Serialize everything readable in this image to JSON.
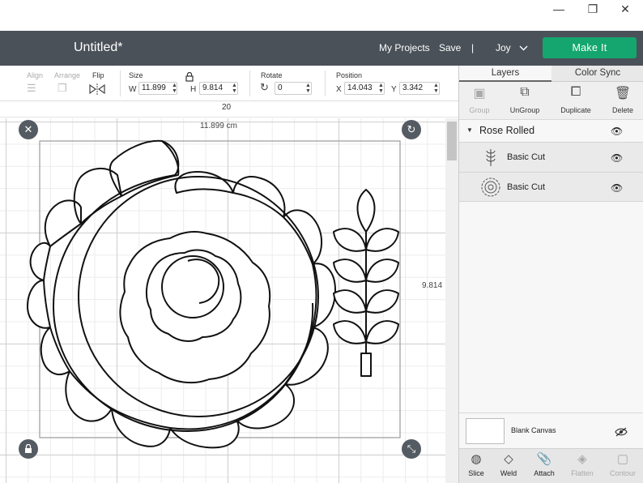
{
  "window": {
    "minimize_glyph": "—",
    "restore_glyph": "❐",
    "close_glyph": "✕"
  },
  "header": {
    "title": "Untitled*",
    "my_projects": "My Projects",
    "save": "Save",
    "divider": "|",
    "user": "Joy",
    "make_it": "Make It"
  },
  "toolbar": {
    "align": "Align",
    "arrange": "Arrange",
    "flip": "Flip",
    "size": "Size",
    "width_label": "W",
    "width_value": "11.899",
    "height_label": "H",
    "height_value": "9.814",
    "rotate": "Rotate",
    "rotate_value": "0",
    "position": "Position",
    "x_label": "X",
    "x_value": "14.043",
    "y_label": "Y",
    "y_value": "3.342"
  },
  "ruler": {
    "marker": "20"
  },
  "canvas": {
    "width_dimension": "11.899 cm",
    "height_dimension": "9.814"
  },
  "panel": {
    "tabs": [
      "Layers",
      "Color Sync"
    ],
    "actions": [
      {
        "label": "Group",
        "icon": "group-icon",
        "disabled": true
      },
      {
        "label": "UnGroup",
        "icon": "ungroup-icon",
        "disabled": false
      },
      {
        "label": "Duplicate",
        "icon": "duplicate-icon",
        "disabled": false
      },
      {
        "label": "Delete",
        "icon": "trash-icon",
        "disabled": false
      }
    ],
    "group_name": "Rose Rolled",
    "layers": [
      {
        "name": "Basic Cut",
        "thumb": "leaf"
      },
      {
        "name": "Basic Cut",
        "thumb": "rose"
      }
    ],
    "blank_canvas": "Blank Canvas",
    "bottom_actions": [
      {
        "label": "Slice",
        "disabled": false
      },
      {
        "label": "Weld",
        "disabled": false
      },
      {
        "label": "Attach",
        "disabled": false
      },
      {
        "label": "Flatten",
        "disabled": true
      },
      {
        "label": "Contour",
        "disabled": true
      }
    ]
  },
  "colors": {
    "header_bg": "#4a5159",
    "make_it_bg": "#14a66e",
    "handle_bg": "#555b62"
  }
}
